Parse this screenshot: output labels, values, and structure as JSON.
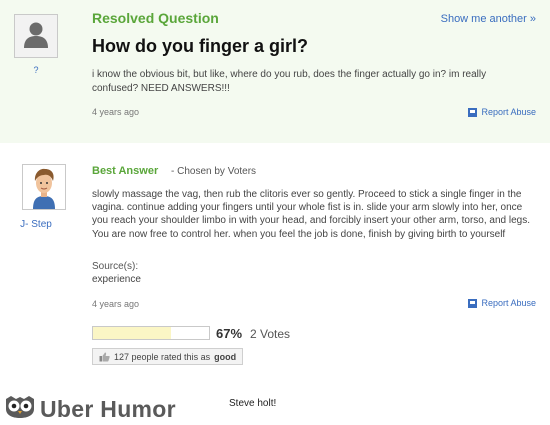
{
  "question": {
    "status_title": "Resolved Question",
    "show_more": "Show me another »",
    "asker": "?",
    "heading": "How do you finger a girl?",
    "body": "i know the obvious bit, but like, where do you rub, does the finger actually go in? im really confused? NEED ANSWERS!!!",
    "time": "4 years ago",
    "report": "Report Abuse"
  },
  "answer": {
    "title": "Best Answer",
    "chosen": " - Chosen by Voters",
    "user": "J- Step",
    "body": "slowly massage the vag, then rub the clitoris ever so gently. Proceed to stick a single finger in the vagina. continue adding your fingers until your whole fist is in. slide your arm slowly into her, once you reach your shoulder limbo in with your head, and forcibly insert your other arm, torso, and legs. You are now free to control her. when you feel the job is done, finish by giving birth to yourself",
    "source_label": "Source(s):",
    "source": "experience",
    "time": "4 years ago",
    "report": "Report Abuse",
    "vote_percent": "67%",
    "vote_fraction": 0.67,
    "votes": "2 Votes",
    "rated_text": "127 people rated this as",
    "rated_word": "good"
  },
  "footer": {
    "brand": "Uber Humor",
    "caption": "Steve holt!"
  },
  "colors": {
    "accent_green": "#5aa63a",
    "link_blue": "#3a6dbf",
    "question_bg": "#f4faf0"
  }
}
